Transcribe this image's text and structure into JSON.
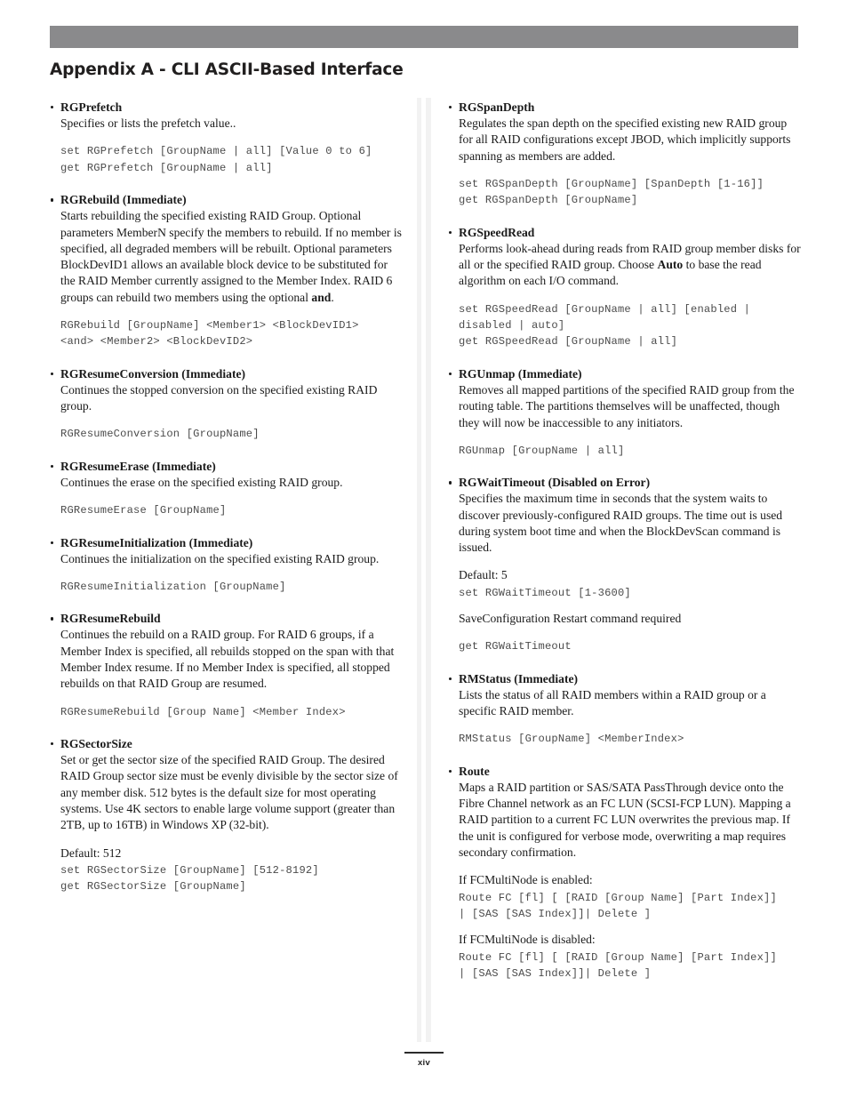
{
  "header": {
    "title": "Appendix A - CLI ASCII-Based Interface",
    "bar_color": "#8a8a8c"
  },
  "footer": {
    "page_number": "xiv"
  },
  "left_column": {
    "entries": [
      {
        "name": "RGPrefetch",
        "description": "Specifies or lists the prefetch value..",
        "code": "set RGPrefetch [GroupName | all] [Value 0 to 6]\nget RGPrefetch [GroupName | all]"
      },
      {
        "name": "RGRebuild (Immediate)",
        "description": "Starts rebuilding the specified existing RAID Group. Optional parameters MemberN specify the members to rebuild. If no member is specified, all degraded members will be rebuilt. Optional parameters BlockDevID1 allows an available block device to be substituted for the RAID Member currently assigned to the Member Index. RAID 6 groups can rebuild two members using the optional ",
        "description_bold_tail": "and",
        "description_tail": ".",
        "code": "RGRebuild [GroupName] <Member1> <BlockDevID1>\n<and> <Member2> <BlockDevID2>"
      },
      {
        "name": "RGResumeConversion (Immediate)",
        "description": "Continues the stopped conversion on the specified existing RAID group.",
        "code": "RGResumeConversion [GroupName]"
      },
      {
        "name": "RGResumeErase (Immediate)",
        "description": "Continues the erase on the specified existing RAID group.",
        "code": "RGResumeErase [GroupName]"
      },
      {
        "name": "RGResumeInitialization (Immediate)",
        "description": "Continues the initialization on the specified existing RAID group.",
        "code": "RGResumeInitialization [GroupName]"
      },
      {
        "name": "RGResumeRebuild",
        "description": "Continues the rebuild on a RAID group. For RAID 6 groups, if a Member Index is specified, all rebuilds stopped on the span with that Member Index resume. If no Member Index is specified, all stopped rebuilds on that RAID Group are resumed.",
        "code": "RGResumeRebuild [Group Name] <Member Index>"
      },
      {
        "name": "RGSectorSize",
        "description": "Set or get the sector size of the specified RAID Group. The desired RAID Group sector size must be evenly divisible by the sector size of any member disk. 512 bytes is the default size for most operating systems. Use 4K sectors to enable large volume support (greater than 2TB, up to 16TB) in Windows XP (32-bit).",
        "note": "Default: 512",
        "code": "set RGSectorSize [GroupName] [512-8192]\nget RGSectorSize [GroupName]"
      }
    ]
  },
  "right_column": {
    "entries": [
      {
        "name": "RGSpanDepth",
        "description": "Regulates the span depth on the specified existing new RAID group for all RAID configurations except JBOD, which implicitly supports spanning as members are added.",
        "code": "set RGSpanDepth [GroupName] [SpanDepth [1-16]]\nget RGSpanDepth [GroupName]"
      },
      {
        "name": "RGSpeedRead",
        "description": "Performs look-ahead during reads from RAID group member disks for all or the specified RAID group. Choose ",
        "description_bold_mid": "Auto",
        "description_tail": " to base the read algorithm on each I/O command.",
        "code": "set RGSpeedRead [GroupName | all] [enabled |\ndisabled | auto]\nget RGSpeedRead [GroupName | all]"
      },
      {
        "name": "RGUnmap (Immediate)",
        "description": "Removes all mapped partitions of the specified RAID group from the routing table. The partitions themselves will be unaffected, though they will now be inaccessible to any initiators.",
        "code": "RGUnmap [GroupName | all]"
      },
      {
        "name": "RGWaitTimeout (Disabled on Error)",
        "description": "Specifies the maximum time in seconds that the system waits to discover previously-configured RAID groups. The time out is used during system boot time and when the BlockDevScan command is issued.",
        "note": "Default: 5",
        "code": "set RGWaitTimeout [1-3600]",
        "note2": "SaveConfiguration Restart command required",
        "code2": "get RGWaitTimeout"
      },
      {
        "name": "RMStatus (Immediate)",
        "description": "Lists the status of all RAID members within a RAID group or a specific RAID member.",
        "code": "RMStatus [GroupName] <MemberIndex>"
      },
      {
        "name": "Route",
        "description": "Maps a RAID partition or SAS/SATA PassThrough device onto the Fibre Channel network as an FC LUN (SCSI-FCP LUN). Mapping a RAID partition to a current FC LUN overwrites the previous map. If the unit is configured for verbose mode, overwriting a map requires secondary confirmation.",
        "note": "If FCMultiNode is enabled:",
        "code": "Route FC [fl] [ [RAID [Group Name] [Part Index]]\n| [SAS [SAS Index]]| Delete ]",
        "note2": "If FCMultiNode is disabled:",
        "code2": "Route FC [fl] [ [RAID [Group Name] [Part Index]]\n| [SAS [SAS Index]]| Delete ]"
      }
    ]
  }
}
